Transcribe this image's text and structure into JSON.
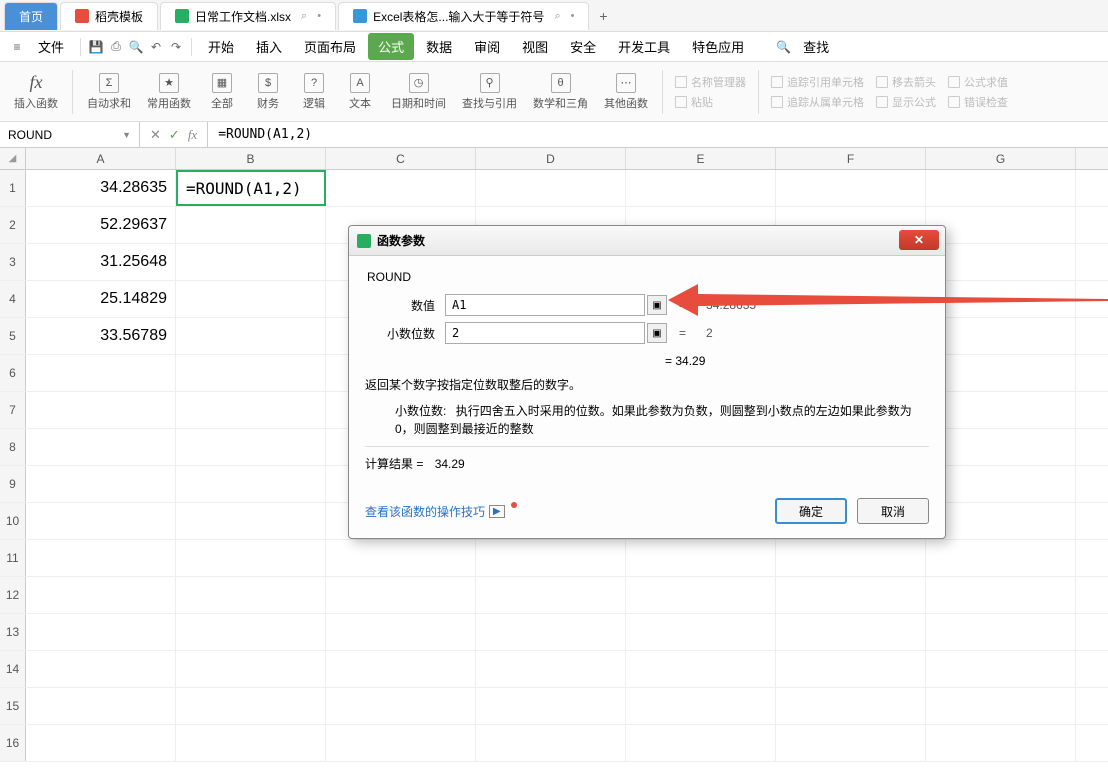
{
  "tabs": {
    "home": "首页",
    "docer": "稻壳模板",
    "current": "日常工作文档.xlsx",
    "excel_article": "Excel表格怎...输入大于等于符号",
    "add": "+"
  },
  "menu": {
    "file": "文件",
    "start": "开始",
    "insert": "插入",
    "layout": "页面布局",
    "formula": "公式",
    "data": "数据",
    "review": "审阅",
    "view": "视图",
    "security": "安全",
    "dev": "开发工具",
    "special": "特色应用",
    "search": "查找"
  },
  "ribbon": {
    "insert_fn": "插入函数",
    "autosum": "自动求和",
    "common": "常用函数",
    "all": "全部",
    "financial": "财务",
    "logical": "逻辑",
    "text": "文本",
    "datetime": "日期和时间",
    "lookup": "查找与引用",
    "math": "数学和三角",
    "other": "其他函数",
    "grp1a": "追踪引用单元格",
    "grp1b": "追踪从属单元格",
    "grp2a": "名称管理器",
    "grp2b": "粘贴",
    "grp3a": "移去箭头",
    "grp3b": "显示公式",
    "grp4a": "公式求值",
    "grp4b": "错误检查"
  },
  "namebox": "ROUND",
  "formula": "=ROUND(A1,2)",
  "columns": [
    "A",
    "B",
    "C",
    "D",
    "E",
    "F",
    "G"
  ],
  "cells": {
    "a1": "34.28635",
    "a2": "52.29637",
    "a3": "31.25648",
    "a4": "25.14829",
    "a5": "33.56789",
    "b1": "=ROUND(A1,2)"
  },
  "dialog": {
    "title": "函数参数",
    "fn": "ROUND",
    "arg1_label": "数值",
    "arg1_val": "A1",
    "arg1_result": "34.28635",
    "arg2_label": "小数位数",
    "arg2_val": "2",
    "arg2_result": "2",
    "interim": "= 34.29",
    "desc1": "返回某个数字按指定位数取整后的数字。",
    "desc2_label": "小数位数:",
    "desc2": "执行四舍五入时采用的位数。如果此参数为负数，则圆整到小数点的左边如果此参数为0，则圆整到最接近的整数",
    "calc_label": "计算结果 =",
    "calc_val": "34.29",
    "tech": "查看该函数的操作技巧",
    "ok": "确定",
    "cancel": "取消"
  }
}
